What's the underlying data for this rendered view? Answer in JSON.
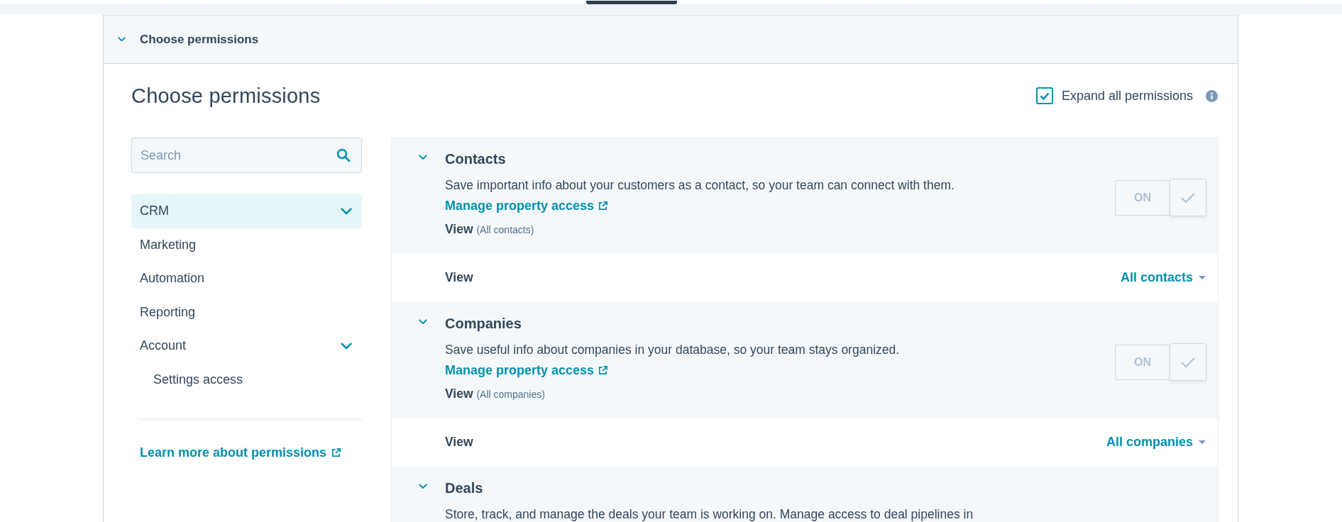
{
  "section_header": {
    "title": "Choose permissions",
    "expanded": true
  },
  "heading": "Choose permissions",
  "expand_all": {
    "label": "Expand all permissions",
    "checked": true
  },
  "search": {
    "placeholder": "Search"
  },
  "sidebar": {
    "items": [
      {
        "label": "CRM",
        "selected": true,
        "expandable": true
      },
      {
        "label": "Marketing",
        "selected": false,
        "expandable": false
      },
      {
        "label": "Automation",
        "selected": false,
        "expandable": false
      },
      {
        "label": "Reporting",
        "selected": false,
        "expandable": false
      },
      {
        "label": "Account",
        "selected": false,
        "expandable": true,
        "children": [
          {
            "label": "Settings access",
            "selected": false,
            "expandable": false
          }
        ]
      }
    ],
    "learn_more": "Learn more about permissions"
  },
  "permissions": [
    {
      "title": "Contacts",
      "expanded": true,
      "description": "Save important info about your customers as a contact, so your team can connect with them.",
      "link": "Manage property access",
      "summary_label": "View",
      "summary_value": "(All contacts)",
      "toggle": {
        "label": "ON",
        "on": true,
        "disabled": true
      },
      "rows": [
        {
          "label": "View",
          "value": "All contacts"
        }
      ]
    },
    {
      "title": "Companies",
      "expanded": true,
      "description": "Save useful info about companies in your database, so your team stays organized.",
      "link": "Manage property access",
      "summary_label": "View",
      "summary_value": "(All companies)",
      "toggle": {
        "label": "ON",
        "on": true,
        "disabled": true
      },
      "rows": [
        {
          "label": "View",
          "value": "All companies"
        }
      ]
    },
    {
      "title": "Deals",
      "expanded": true,
      "description": "Store, track, and manage the deals your team is working on. Manage access to deal pipelines in"
    }
  ]
}
